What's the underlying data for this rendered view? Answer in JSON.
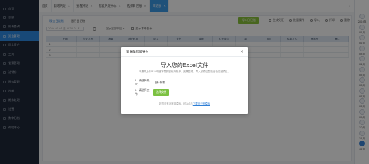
{
  "sidebar": {
    "items": [
      {
        "label": "首页",
        "icon": "home-icon"
      },
      {
        "label": "总账",
        "icon": "ledger-icon"
      },
      {
        "label": "账表查询",
        "icon": "report-icon"
      },
      {
        "label": "资金管理",
        "icon": "fund-icon",
        "active": true
      },
      {
        "label": "固定资产",
        "icon": "asset-icon"
      },
      {
        "label": "工资",
        "icon": "salary-icon"
      },
      {
        "label": "发票管理",
        "icon": "invoice-icon"
      },
      {
        "label": "进销存",
        "icon": "stock-icon"
      },
      {
        "label": "税务管理",
        "icon": "tax-icon"
      },
      {
        "label": "出纳",
        "icon": "cashier-icon"
      },
      {
        "label": "期末处理",
        "icon": "closing-icon"
      },
      {
        "label": "设置",
        "icon": "settings-icon"
      },
      {
        "label": "数字归档",
        "icon": "archive-icon"
      },
      {
        "label": "帮助中心",
        "icon": "help-icon"
      }
    ]
  },
  "tabs": [
    {
      "label": "首页",
      "closable": false
    },
    {
      "label": "新增凭证",
      "closable": true
    },
    {
      "label": "查看凭证",
      "closable": true
    },
    {
      "label": "智能凭证中心",
      "closable": true
    },
    {
      "label": "选择日记账",
      "closable": true
    },
    {
      "label": "日记账",
      "closable": true,
      "active": true
    }
  ],
  "subtabs": [
    "现金日记账",
    "银行日记账"
  ],
  "actions": {
    "primary": "导入日记账",
    "items": [
      "生成凭证",
      "批量操作",
      "导入",
      "打印",
      "删除"
    ]
  },
  "toolbar": {
    "date_value": "2024-01-01 至 2024-01-31",
    "select_label": "显示全部科目",
    "check_label": "显示本年合计"
  },
  "grid": {
    "headers": [
      "日期",
      "凭证字号",
      "摘要",
      "对方科目",
      "收入",
      "支出",
      "余额",
      "往来单位",
      "部门",
      "项目",
      "结算方式",
      "票据号",
      "备注"
    ],
    "rows": [
      [
        "1",
        "",
        "",
        "",
        "",
        "",
        "",
        "",
        "",
        "",
        "",
        "",
        "",
        ""
      ],
      [
        "2",
        "",
        "",
        "",
        "",
        "",
        "",
        "",
        "",
        "",
        "",
        "",
        "",
        ""
      ],
      [
        "3",
        "",
        "",
        "",
        "",
        "",
        "",
        "",
        "",
        "",
        "",
        "",
        "",
        ""
      ]
    ]
  },
  "rail": {
    "labels": [
      "2024年",
      "01月",
      "02月",
      "03月",
      "04月",
      "05月",
      "06月",
      "07月",
      "08月",
      "09月",
      "10月",
      "11月",
      "12月"
    ]
  },
  "modal": {
    "header": "对账单智能导入",
    "title": "导入您的Excel文件",
    "description": "只需单上传每个明细下载的银行对账单，无需整理，导入软件后智能自动匹配项目。",
    "step1_label": "1、请选择账户：",
    "step1_value": "银行存款",
    "step2_label": "2、请选择文件：",
    "step2_button": "选择文件",
    "footer_text": "若您没有对账单模板，可以点击",
    "footer_link": "下载日记账模板"
  }
}
